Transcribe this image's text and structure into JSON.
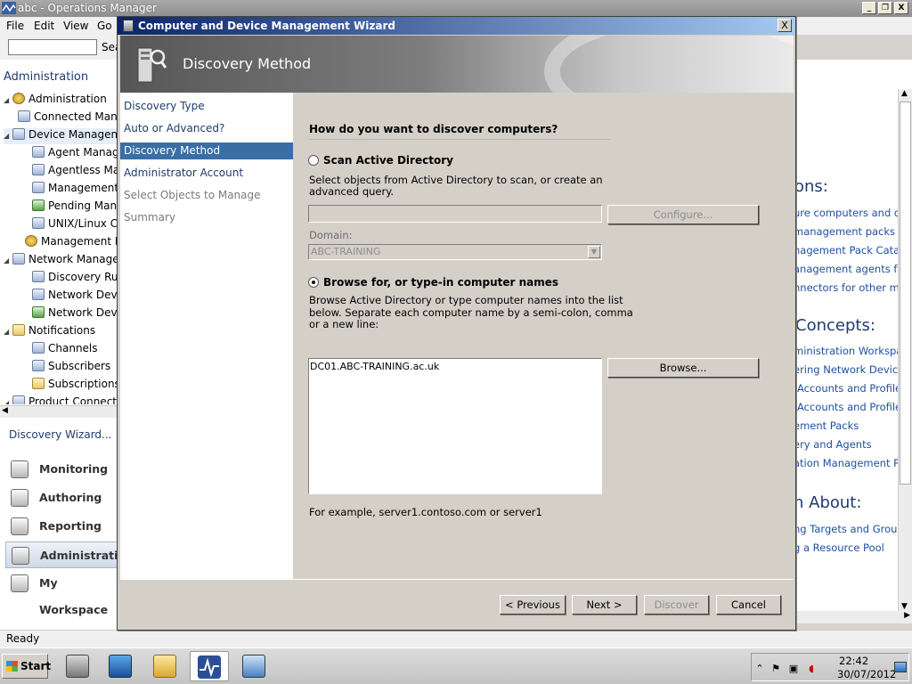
{
  "app": {
    "title": "abc - Operations Manager",
    "minimize_glyph": "_",
    "restore_glyph": "❐",
    "close_glyph": "X"
  },
  "menu": [
    "File",
    "Edit",
    "View",
    "Go"
  ],
  "toolbar": {
    "search_label": "Sea"
  },
  "left_pane": {
    "title": "Administration",
    "tree": [
      {
        "label": "Administration",
        "level": 0,
        "expander": "◢",
        "icon": "gear"
      },
      {
        "label": "Connected Mana",
        "level": 1,
        "expander": "",
        "icon": "box"
      },
      {
        "label": "Device Managen",
        "level": 1,
        "expander": "◢",
        "icon": "box"
      },
      {
        "label": "Agent Manage",
        "level": 2,
        "expander": "",
        "icon": "box"
      },
      {
        "label": "Agentless Man",
        "level": 2,
        "expander": "",
        "icon": "box"
      },
      {
        "label": "Management S",
        "level": 2,
        "expander": "",
        "icon": "box"
      },
      {
        "label": "Pending Manag",
        "level": 2,
        "expander": "",
        "icon": "green"
      },
      {
        "label": "UNIX/Linux Cor",
        "level": 2,
        "expander": "",
        "icon": "box"
      },
      {
        "label": "Management Pa",
        "level": 1,
        "expander": "",
        "icon": "gear"
      },
      {
        "label": "Network Manage",
        "level": 1,
        "expander": "◢",
        "icon": "box"
      },
      {
        "label": "Discovery Rules",
        "level": 2,
        "expander": "",
        "icon": "box"
      },
      {
        "label": "Network Device",
        "level": 2,
        "expander": "",
        "icon": "box"
      },
      {
        "label": "Network Device",
        "level": 2,
        "expander": "",
        "icon": "green"
      },
      {
        "label": "Notifications",
        "level": 1,
        "expander": "◢",
        "icon": "mail"
      },
      {
        "label": "Channels",
        "level": 2,
        "expander": "",
        "icon": "box"
      },
      {
        "label": "Subscribers",
        "level": 2,
        "expander": "",
        "icon": "box"
      },
      {
        "label": "Subscriptions",
        "level": 2,
        "expander": "",
        "icon": "mail"
      },
      {
        "label": "Product Connect",
        "level": 1,
        "expander": "◢",
        "icon": "box"
      }
    ],
    "action_link": "Discovery Wizard...",
    "nav_buttons": [
      {
        "label": "Monitoring",
        "active": false
      },
      {
        "label": "Authoring",
        "active": false
      },
      {
        "label": "Reporting",
        "active": false
      },
      {
        "label": "Administration",
        "active": true
      },
      {
        "label": "My Workspace",
        "active": false
      }
    ]
  },
  "right_pane": {
    "headings": [
      "ons:",
      "Concepts:",
      "n About:"
    ],
    "links_group1": [
      "ure computers and dev",
      "management packs",
      "nagement Pack Catalo",
      "anagement agents for",
      "nnectors for other man"
    ],
    "links_group2": [
      "ministration Workspac",
      "ering Network Devices",
      "Accounts and Profiles",
      "Accounts and Profiles f",
      "ement Packs",
      "ery and Agents",
      "ation Management Pack"
    ],
    "links_group3": [
      "ng Targets and Groups",
      "g a Resource Pool"
    ]
  },
  "status": {
    "text": "Ready"
  },
  "taskbar": {
    "start_label": "Start",
    "clock_time": "22:42",
    "clock_date": "30/07/2012"
  },
  "wizard": {
    "title": "Computer and Device Management Wizard",
    "close_glyph": "X",
    "header_title": "Discovery Method",
    "steps": [
      {
        "label": "Discovery Type",
        "state": "done"
      },
      {
        "label": "Auto or Advanced?",
        "state": "done"
      },
      {
        "label": "Discovery Method",
        "state": "current"
      },
      {
        "label": "Administrator Account",
        "state": "done"
      },
      {
        "label": "Select Objects to Manage",
        "state": "disabled"
      },
      {
        "label": "Summary",
        "state": "disabled"
      }
    ],
    "question": "How do you want to discover computers?",
    "option_scan": {
      "label": "Scan Active Directory",
      "checked": false,
      "desc_line1": "Select objects from Active Directory to scan, or create an",
      "desc_line2": "advanced query.",
      "query_value": "",
      "configure_label": "Configure...",
      "domain_label": "Domain:",
      "domain_value": "ABC-TRAINING"
    },
    "option_browse": {
      "label": "Browse for, or type-in computer names",
      "checked": true,
      "desc_line1": "Browse Active Directory or type computer names into the list",
      "desc_line2": "below. Separate each computer name by a semi-colon, comma",
      "desc_line3": "or a new line:",
      "computer_names": "DC01.ABC-TRAINING.ac.uk",
      "browse_label": "Browse...",
      "example": "For example, server1.contoso.com or server1"
    },
    "buttons": {
      "previous": "< Previous",
      "next": "Next >",
      "discover": "Discover",
      "cancel": "Cancel"
    }
  }
}
